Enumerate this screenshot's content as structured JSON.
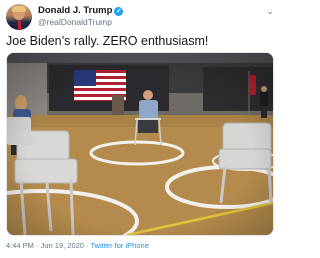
{
  "tweet": {
    "display_name": "Donald J. Trump",
    "handle": "@realDonaldTrump",
    "verified_icon": "✓",
    "text": "Joe Biden’s rally. ZERO enthusiasm!",
    "timestamp": "4:44 PM · Jun 19, 2020",
    "separator": " · ",
    "source": "Twitter for iPhone"
  },
  "icons": {
    "chevron": "⌄"
  },
  "colors": {
    "link": "#1b95e0",
    "verified": "#1da1f2",
    "muted": "#657786"
  }
}
